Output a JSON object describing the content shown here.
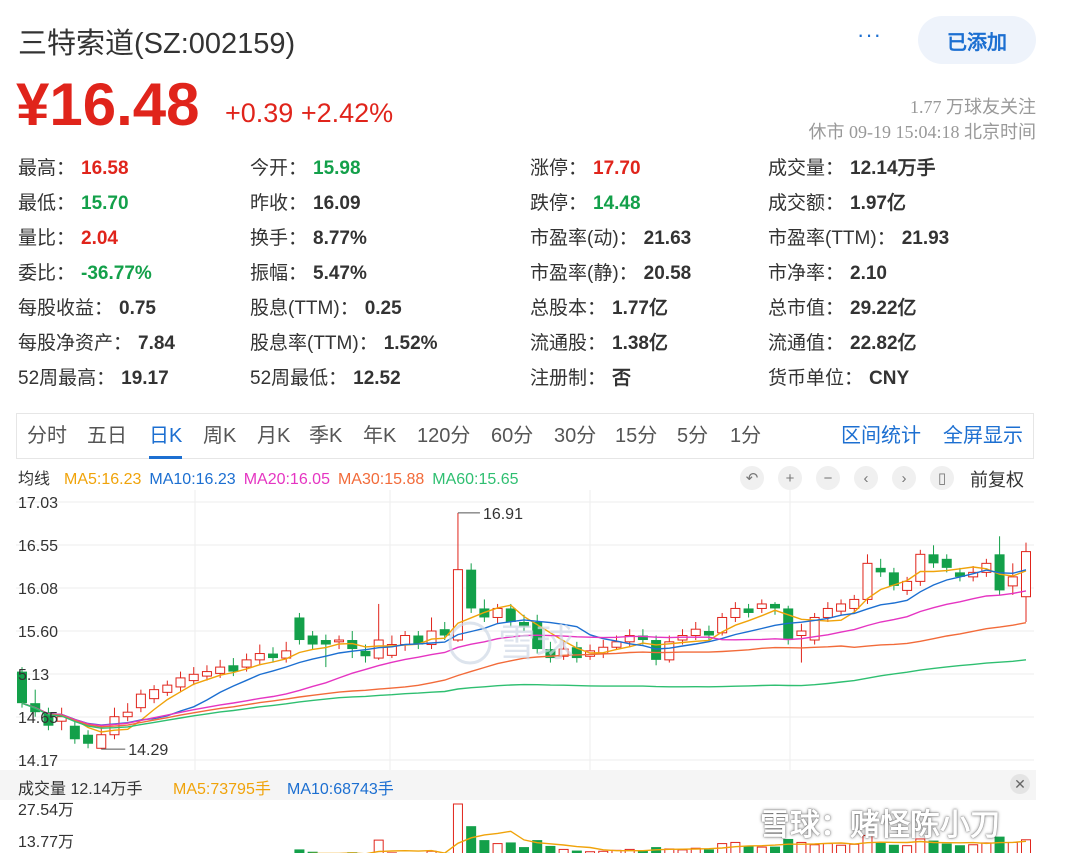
{
  "header": {
    "title": "三特索道(SZ:002159)",
    "more_label": "···",
    "added_label": "已添加"
  },
  "price": {
    "current": "¥16.48",
    "change": "+0.39",
    "change_pct": "+2.42%",
    "followers": "1.77 万球友关注",
    "status": "休市 09-19 15:04:18 北京时间"
  },
  "quote": [
    [
      {
        "label": "最高：",
        "value": "16.58",
        "tone": "red"
      },
      {
        "label": "今开：",
        "value": "15.98",
        "tone": "green"
      },
      {
        "label": "涨停：",
        "value": "17.70",
        "tone": "red"
      },
      {
        "label": "成交量：",
        "value": "12.14万手",
        "tone": ""
      }
    ],
    [
      {
        "label": "最低：",
        "value": "15.70",
        "tone": "green"
      },
      {
        "label": "昨收：",
        "value": "16.09",
        "tone": ""
      },
      {
        "label": "跌停：",
        "value": "14.48",
        "tone": "green"
      },
      {
        "label": "成交额：",
        "value": "1.97亿",
        "tone": ""
      }
    ],
    [
      {
        "label": "量比：",
        "value": "2.04",
        "tone": "red"
      },
      {
        "label": "换手：",
        "value": "8.77%",
        "tone": ""
      },
      {
        "label": "市盈率(动)：",
        "value": "21.63",
        "tone": ""
      },
      {
        "label": "市盈率(TTM)：",
        "value": "21.93",
        "tone": ""
      }
    ],
    [
      {
        "label": "委比：",
        "value": "-36.77%",
        "tone": "green"
      },
      {
        "label": "振幅：",
        "value": "5.47%",
        "tone": ""
      },
      {
        "label": "市盈率(静)：",
        "value": "20.58",
        "tone": ""
      },
      {
        "label": "市净率：",
        "value": "2.10",
        "tone": ""
      }
    ],
    [
      {
        "label": "每股收益：",
        "value": "0.75",
        "tone": ""
      },
      {
        "label": "股息(TTM)：",
        "value": "0.25",
        "tone": ""
      },
      {
        "label": "总股本：",
        "value": "1.77亿",
        "tone": ""
      },
      {
        "label": "总市值：",
        "value": "29.22亿",
        "tone": ""
      }
    ],
    [
      {
        "label": "每股净资产：",
        "value": "7.84",
        "tone": ""
      },
      {
        "label": "股息率(TTM)：",
        "value": "1.52%",
        "tone": ""
      },
      {
        "label": "流通股：",
        "value": "1.38亿",
        "tone": ""
      },
      {
        "label": "流通值：",
        "value": "22.82亿",
        "tone": ""
      }
    ],
    [
      {
        "label": "52周最高：",
        "value": "19.17",
        "tone": ""
      },
      {
        "label": "52周最低：",
        "value": "12.52",
        "tone": ""
      },
      {
        "label": "注册制：",
        "value": "否",
        "tone": ""
      },
      {
        "label": "货币单位：",
        "value": "CNY",
        "tone": ""
      }
    ]
  ],
  "tabs": [
    "分时",
    "五日",
    "日K",
    "周K",
    "月K",
    "季K",
    "年K",
    "120分",
    "60分",
    "30分",
    "15分",
    "5分",
    "1分"
  ],
  "active_tab": "日K",
  "tab_links": [
    "区间统计",
    "全屏显示"
  ],
  "ma_legend": {
    "label": "均线",
    "items": [
      {
        "text": "MA5:16.23",
        "color": "#f0a30a"
      },
      {
        "text": "MA10:16.23",
        "color": "#1c6fd1"
      },
      {
        "text": "MA20:16.05",
        "color": "#e535c2"
      },
      {
        "text": "MA30:15.88",
        "color": "#f26b3a"
      },
      {
        "text": "MA60:15.65",
        "color": "#2fbf71"
      }
    ]
  },
  "toolbar": {
    "icons": [
      "undo-icon",
      "zoom-in-icon",
      "zoom-out-icon",
      "pan-left-icon",
      "pan-right-icon",
      "candle-toggle-icon"
    ],
    "glyphs": [
      "↶",
      "+",
      "−",
      "‹",
      "›",
      "▯"
    ],
    "adjust_label": "前复权"
  },
  "chart_data": {
    "type": "candlestick",
    "y_ticks": [
      "17.03",
      "16.55",
      "16.08",
      "15.60",
      "5.13",
      "14.65",
      "14.17"
    ],
    "ylim": [
      14.17,
      17.03
    ],
    "annotations": [
      {
        "text": "16.91",
        "value": 16.91
      },
      {
        "text": "14.29",
        "value": 14.29
      }
    ],
    "candles": [
      [
        15.15,
        14.8,
        15.2,
        14.75
      ],
      [
        14.8,
        14.7,
        14.95,
        14.65
      ],
      [
        14.7,
        14.55,
        14.75,
        14.5
      ],
      [
        14.6,
        14.65,
        14.75,
        14.5
      ],
      [
        14.55,
        14.4,
        14.6,
        14.35
      ],
      [
        14.45,
        14.35,
        14.5,
        14.3
      ],
      [
        14.3,
        14.45,
        14.55,
        14.29
      ],
      [
        14.45,
        14.65,
        14.75,
        14.4
      ],
      [
        14.65,
        14.7,
        14.8,
        14.6
      ],
      [
        14.75,
        14.9,
        14.95,
        14.7
      ],
      [
        14.85,
        14.95,
        15.0,
        14.8
      ],
      [
        14.92,
        15.0,
        15.05,
        14.88
      ],
      [
        14.98,
        15.08,
        15.15,
        14.92
      ],
      [
        15.05,
        15.12,
        15.2,
        15.0
      ],
      [
        15.1,
        15.15,
        15.22,
        15.05
      ],
      [
        15.13,
        15.2,
        15.28,
        15.08
      ],
      [
        15.22,
        15.15,
        15.3,
        15.1
      ],
      [
        15.2,
        15.28,
        15.35,
        15.15
      ],
      [
        15.28,
        15.35,
        15.45,
        15.22
      ],
      [
        15.35,
        15.3,
        15.42,
        15.25
      ],
      [
        15.3,
        15.38,
        15.48,
        15.25
      ],
      [
        15.75,
        15.5,
        15.8,
        15.45
      ],
      [
        15.55,
        15.45,
        15.6,
        15.4
      ],
      [
        15.5,
        15.45,
        15.56,
        15.2
      ],
      [
        15.48,
        15.5,
        15.55,
        15.4
      ],
      [
        15.5,
        15.4,
        15.6,
        15.3
      ],
      [
        15.38,
        15.32,
        15.45,
        15.25
      ],
      [
        15.3,
        15.5,
        15.9,
        15.28
      ],
      [
        15.33,
        15.45,
        15.55,
        15.3
      ],
      [
        15.45,
        15.55,
        15.6,
        15.38
      ],
      [
        15.55,
        15.45,
        15.6,
        15.4
      ],
      [
        15.45,
        15.6,
        15.75,
        15.4
      ],
      [
        15.62,
        15.55,
        15.7,
        15.5
      ],
      [
        15.5,
        16.28,
        16.91,
        15.48
      ],
      [
        16.28,
        15.85,
        16.35,
        15.8
      ],
      [
        15.85,
        15.75,
        15.95,
        15.7
      ],
      [
        15.75,
        15.85,
        15.9,
        15.68
      ],
      [
        15.85,
        15.7,
        15.9,
        15.65
      ],
      [
        15.7,
        15.65,
        15.78,
        15.6
      ],
      [
        15.7,
        15.4,
        15.78,
        15.35
      ],
      [
        15.4,
        15.3,
        15.48,
        15.25
      ],
      [
        15.32,
        15.4,
        15.5,
        15.28
      ],
      [
        15.42,
        15.3,
        15.48,
        15.25
      ],
      [
        15.32,
        15.38,
        15.45,
        15.28
      ],
      [
        15.35,
        15.42,
        15.5,
        15.3
      ],
      [
        15.42,
        15.48,
        15.55,
        15.4
      ],
      [
        15.48,
        15.55,
        15.62,
        15.42
      ],
      [
        15.55,
        15.5,
        15.62,
        15.45
      ],
      [
        15.5,
        15.28,
        15.55,
        15.22
      ],
      [
        15.28,
        15.48,
        15.55,
        15.25
      ],
      [
        15.5,
        15.55,
        15.62,
        15.45
      ],
      [
        15.55,
        15.62,
        15.7,
        15.5
      ],
      [
        15.6,
        15.55,
        15.66,
        15.48
      ],
      [
        15.58,
        15.75,
        15.8,
        15.55
      ],
      [
        15.75,
        15.85,
        15.92,
        15.7
      ],
      [
        15.85,
        15.8,
        15.9,
        15.75
      ],
      [
        15.85,
        15.9,
        15.95,
        15.8
      ],
      [
        15.9,
        15.85,
        15.92,
        15.78
      ],
      [
        15.85,
        15.5,
        15.88,
        15.45
      ],
      [
        15.55,
        15.6,
        15.68,
        15.25
      ],
      [
        15.5,
        15.75,
        15.8,
        15.45
      ],
      [
        15.75,
        15.85,
        15.92,
        15.7
      ],
      [
        15.82,
        15.9,
        15.95,
        15.78
      ],
      [
        15.85,
        15.95,
        16.0,
        15.8
      ],
      [
        15.95,
        16.35,
        16.45,
        15.9
      ],
      [
        16.3,
        16.25,
        16.4,
        16.2
      ],
      [
        16.25,
        16.1,
        16.3,
        16.05
      ],
      [
        16.05,
        16.15,
        16.2,
        16.0
      ],
      [
        16.15,
        16.45,
        16.5,
        16.1
      ],
      [
        16.45,
        16.35,
        16.55,
        16.3
      ],
      [
        16.4,
        16.3,
        16.45,
        16.25
      ],
      [
        16.25,
        16.2,
        16.3,
        16.15
      ],
      [
        16.2,
        16.25,
        16.32,
        16.15
      ],
      [
        16.25,
        16.35,
        16.4,
        16.2
      ],
      [
        16.45,
        16.05,
        16.65,
        16.0
      ],
      [
        16.1,
        16.2,
        16.35,
        16.0
      ],
      [
        15.98,
        16.48,
        16.58,
        15.7
      ]
    ]
  },
  "volume": {
    "label": "成交量 12.14万手",
    "ma5": "MA5:73795手",
    "ma10": "MA10:68743手",
    "y_ticks": [
      "27.54万",
      "13.77万"
    ],
    "values": [
      4.2,
      3.0,
      2.5,
      2.2,
      2.0,
      3.5,
      4.8,
      5.5,
      6.0,
      5.2,
      4.8,
      5.0,
      4.6,
      4.4,
      4.5,
      4.8,
      5.2,
      5.0,
      5.5,
      5.3,
      5.6,
      8.0,
      7.0,
      5.5,
      5.2,
      6.8,
      6.0,
      12.0,
      6.5,
      6.0,
      5.8,
      7.2,
      6.5,
      27.54,
      18.0,
      12.0,
      10.5,
      11.0,
      9.0,
      12.0,
      9.5,
      8.0,
      7.5,
      7.0,
      7.2,
      7.6,
      8.0,
      7.4,
      9.0,
      8.2,
      7.8,
      8.5,
      8.0,
      10.5,
      11.0,
      9.5,
      9.0,
      9.2,
      12.5,
      11.0,
      10.0,
      10.5,
      9.8,
      10.2,
      14.0,
      11.0,
      10.0,
      9.6,
      12.5,
      11.8,
      10.5,
      9.8,
      10.0,
      10.8,
      13.5,
      11.0,
      12.14
    ]
  },
  "watermark": "雪球：赌怪陈小刀"
}
